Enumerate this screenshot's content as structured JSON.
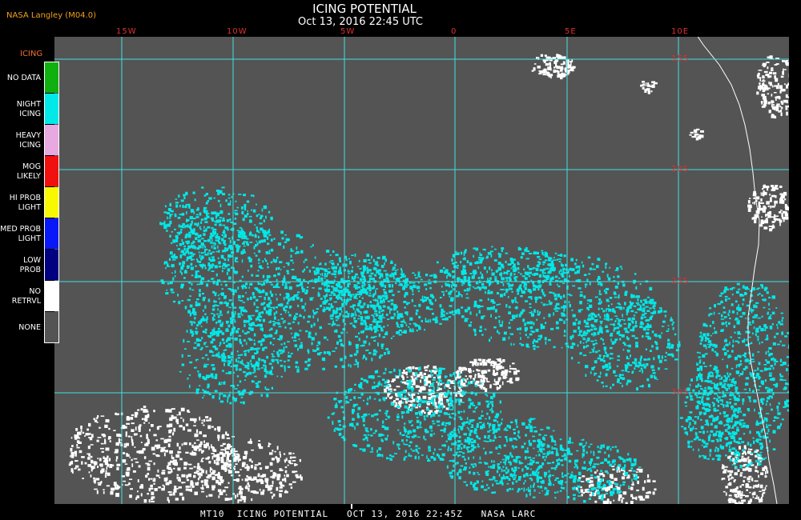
{
  "header": {
    "credit": "NASA Langley (M04.0)",
    "title": "ICING POTENTIAL",
    "subtitle": "Oct 13, 2016 22:45 UTC"
  },
  "axes": {
    "lon_labels": [
      "15W",
      "10W",
      "5W",
      "0",
      "5E",
      "10E"
    ],
    "lat_labels": [
      "15S",
      "20S",
      "25S",
      "30S"
    ],
    "grid_color": "#40e0e0",
    "label_color": "#e03030"
  },
  "legend": {
    "title": "ICING",
    "items": [
      {
        "label": "NO DATA",
        "color": "#10b010"
      },
      {
        "label": "NIGHT\nICING",
        "color": "#00e8e8"
      },
      {
        "label": "HEAVY\nICING",
        "color": "#e8a8e0"
      },
      {
        "label": "MOG\nLIKELY",
        "color": "#f01010"
      },
      {
        "label": "HI PROB\nLIGHT",
        "color": "#f8f800"
      },
      {
        "label": "MED PROB\nLIGHT",
        "color": "#0818f8"
      },
      {
        "label": "LOW\nPROB",
        "color": "#000080"
      },
      {
        "label": "NO\nRETRVL",
        "color": "#ffffff"
      },
      {
        "label": "NONE",
        "color": "#545454"
      }
    ]
  },
  "footer": {
    "text": "MT10  ICING POTENTIAL   OCT 13, 2016 22:45Z   NASA LARC"
  }
}
